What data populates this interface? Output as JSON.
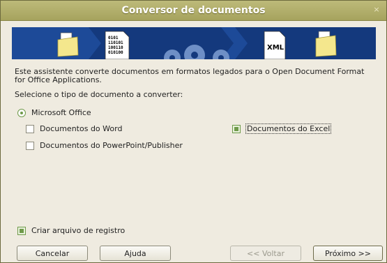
{
  "window": {
    "title": "Conversor de documentos",
    "close_glyph": "×"
  },
  "banner": {
    "binary_lines": [
      "0101",
      "110101",
      "100110",
      "010100"
    ],
    "xml_label": "XML"
  },
  "intro_text": "Este assistente converte documentos em formatos legados para o Open Document Format for Office Applications.",
  "choose_label": "Selecione o tipo de documento a converter:",
  "doc_type": {
    "option_label": "Microsoft Office",
    "options": {
      "word": {
        "label": "Documentos do Word",
        "checked": false
      },
      "excel": {
        "label": "Documentos do Excel",
        "checked": true
      },
      "powerpoint": {
        "label": "Documentos do PowerPoint/Publisher",
        "checked": false
      }
    }
  },
  "log": {
    "label": "Criar arquivo de registro",
    "checked": true
  },
  "buttons": {
    "cancel": "Cancelar",
    "help": "Ajuda",
    "back": "<< Voltar",
    "next": "Próximo >>"
  }
}
